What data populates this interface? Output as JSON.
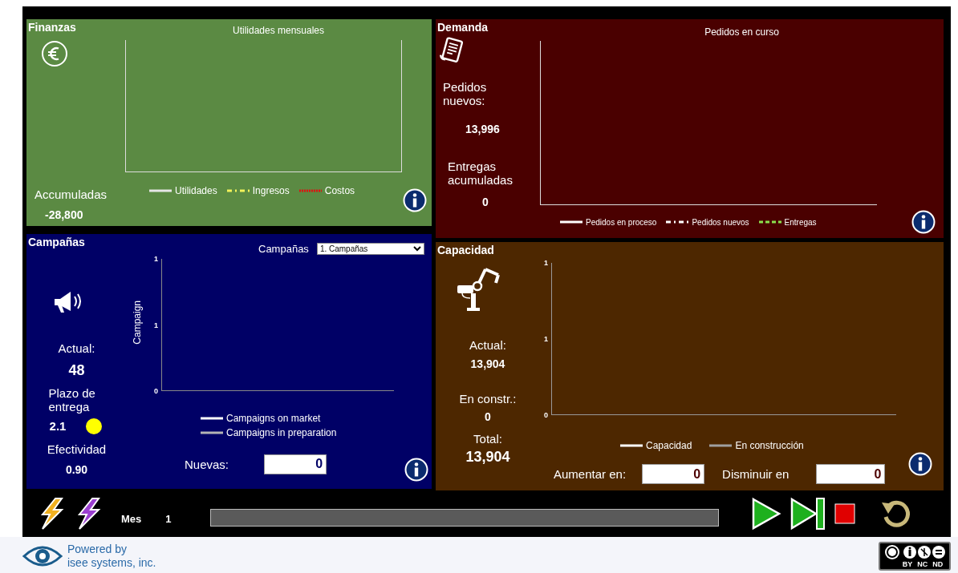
{
  "finanzas": {
    "title": "Finanzas",
    "stats": [
      {
        "label": "Accumuladas",
        "value": "-28,800"
      }
    ],
    "chart": {
      "title": "Utilidades mensuales",
      "legend": [
        {
          "label": "Utilidades",
          "color": "#e6e6e6",
          "kind": "solid"
        },
        {
          "label": "Ingresos",
          "color": "#f2f25a",
          "kind": "dashdot"
        },
        {
          "label": "Costos",
          "color": "#e01010",
          "kind": "dotted"
        }
      ]
    }
  },
  "demanda": {
    "title": "Demanda",
    "stats": [
      {
        "label": "Pedidos nuevos:",
        "value": "13,996"
      },
      {
        "label": "Entregas acumuladas",
        "value": "0"
      }
    ],
    "chart": {
      "title": "Pedidos en curso",
      "legend": [
        {
          "label": "Pedidos en proceso",
          "color": "#ffffff",
          "kind": "solid"
        },
        {
          "label": "Pedidos nuevos",
          "color": "#ffffff",
          "kind": "dashdot"
        },
        {
          "label": "Entregas",
          "color": "#8be04e",
          "kind": "dashed"
        }
      ]
    }
  },
  "campanas": {
    "title": "Campañas",
    "selector": {
      "label": "Campañas",
      "value": "1. Campañas"
    },
    "stats": [
      {
        "label": "Actual:",
        "value": "48"
      },
      {
        "label": "Plazo de entrega",
        "value": "2.1",
        "color": "#ffff00"
      },
      {
        "label": "Efectividad",
        "value": "0.90"
      }
    ],
    "chart": {
      "ylabel": "Campaign",
      "ytick_labels": [
        "1",
        "1",
        "0"
      ],
      "legend": [
        {
          "label": "Campaigns on market",
          "color": "#ffffff",
          "kind": "solid"
        },
        {
          "label": "Campaigns in preparation",
          "color": "#b4b4b4",
          "kind": "solid"
        }
      ]
    },
    "input": {
      "label": "Nuevas:",
      "value": "0"
    }
  },
  "capacidad": {
    "title": "Capacidad",
    "stats": [
      {
        "label": "Actual:",
        "value": "13,904"
      },
      {
        "label": "En constr.:",
        "value": "0"
      },
      {
        "label": "Total:",
        "value": "13,904"
      }
    ],
    "chart": {
      "ytick_labels": [
        "1",
        "1",
        "0"
      ],
      "legend": [
        {
          "label": "Capacidad",
          "color": "#ffffff",
          "kind": "solid"
        },
        {
          "label": "En construcción",
          "color": "#a0a0a0",
          "kind": "solid"
        }
      ]
    },
    "inputs": [
      {
        "label": "Aumentar en:",
        "value": "0"
      },
      {
        "label": "Disminuir en",
        "value": "0"
      }
    ]
  },
  "controls": {
    "month_label": "Mes",
    "month_value": "1"
  },
  "footer": {
    "powered_by": "Powered by\nisee systems, inc.",
    "license_labels": [
      "BY",
      "NC",
      "ND"
    ]
  }
}
